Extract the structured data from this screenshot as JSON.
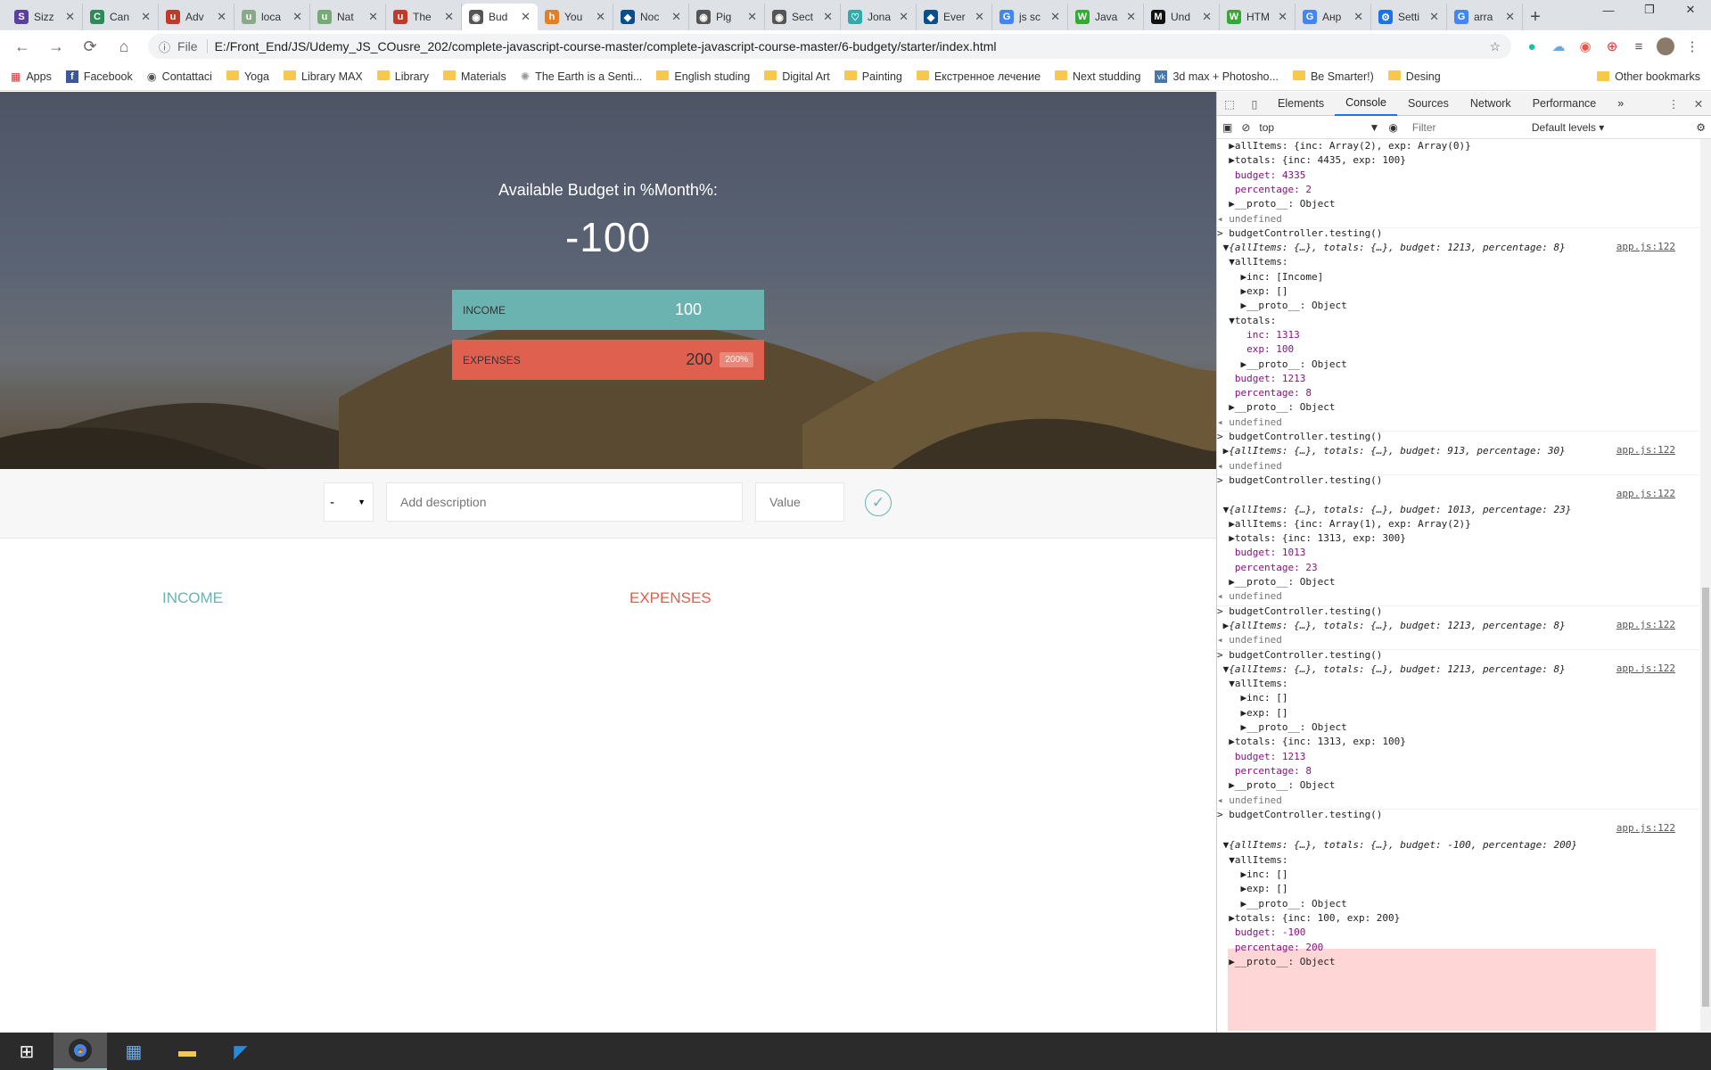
{
  "browser": {
    "tabs": [
      {
        "label": "Sizz",
        "color": "#5a3fa0",
        "glyph": "S"
      },
      {
        "label": "Can",
        "color": "#2e8b57",
        "glyph": "C"
      },
      {
        "label": "Adv",
        "color": "#c0392b",
        "glyph": "u"
      },
      {
        "label": "loca",
        "color": "#8a8",
        "glyph": "u"
      },
      {
        "label": "Nat",
        "color": "#7a7",
        "glyph": "u"
      },
      {
        "label": "The",
        "color": "#c0392b",
        "glyph": "u"
      },
      {
        "label": "Bud",
        "color": "#555",
        "glyph": "◉",
        "active": true
      },
      {
        "label": "You",
        "color": "#e67e22",
        "glyph": "h"
      },
      {
        "label": "Noc",
        "color": "#0b4f8a",
        "glyph": "◆"
      },
      {
        "label": "Pig",
        "color": "#555",
        "glyph": "◉"
      },
      {
        "label": "Sect",
        "color": "#555",
        "glyph": "◉"
      },
      {
        "label": "Jona",
        "color": "#3aa",
        "glyph": "♡"
      },
      {
        "label": "Ever",
        "color": "#0b4f8a",
        "glyph": "◆"
      },
      {
        "label": "js sc",
        "color": "#4285f4",
        "glyph": "G"
      },
      {
        "label": "Java",
        "color": "#3a3",
        "glyph": "W"
      },
      {
        "label": "Und",
        "color": "#111",
        "glyph": "M"
      },
      {
        "label": "HTM",
        "color": "#3a3",
        "glyph": "W"
      },
      {
        "label": "Анр",
        "color": "#4285f4",
        "glyph": "G"
      },
      {
        "label": "Setti",
        "color": "#1a73e8",
        "glyph": "⚙"
      },
      {
        "label": "arra",
        "color": "#4285f4",
        "glyph": "G"
      }
    ],
    "url_scheme": "File",
    "url": "E:/Front_End/JS/Udemy_JS_COusre_202/complete-javascript-course-master/complete-javascript-course-master/6-budgety/starter/index.html",
    "bookmarks": [
      {
        "label": "Apps",
        "type": "apps"
      },
      {
        "label": "Facebook",
        "type": "fb"
      },
      {
        "label": "Contattaci",
        "type": "globe"
      },
      {
        "label": "Yoga",
        "type": "folder"
      },
      {
        "label": "Library MAX",
        "type": "folder"
      },
      {
        "label": "Library",
        "type": "folder"
      },
      {
        "label": "Materials",
        "type": "folder"
      },
      {
        "label": "The Earth is a Senti...",
        "type": "sun"
      },
      {
        "label": "English studing",
        "type": "folder"
      },
      {
        "label": "Digital Art",
        "type": "folder"
      },
      {
        "label": "Painting",
        "type": "folder"
      },
      {
        "label": "Екстренное лечение",
        "type": "folder"
      },
      {
        "label": "Next studding",
        "type": "folder"
      },
      {
        "label": "3d max + Photosho...",
        "type": "vk"
      },
      {
        "label": "Be Smarter!)",
        "type": "folder"
      },
      {
        "label": "Desing",
        "type": "folder"
      }
    ],
    "bookmarks_overflow": "»",
    "other_bookmarks": "Other bookmarks"
  },
  "app": {
    "budget_title": "Available Budget in %Month%:",
    "budget_value": "-100",
    "income_label": "Income",
    "income_value": "100",
    "expenses_label": "Expenses",
    "expenses_value": "200",
    "expenses_percentage": "200%",
    "type_select": "-",
    "description_placeholder": "Add description",
    "value_placeholder": "Value",
    "income_list_title": "Income",
    "expenses_list_title": "Expenses",
    "colors": {
      "income": "#6bb3b0",
      "expenses": "#e0604f"
    }
  },
  "devtools": {
    "tabs": [
      "Elements",
      "Console",
      "Sources",
      "Network",
      "Performance"
    ],
    "active_tab": "Console",
    "context": "top",
    "filter_placeholder": "Filter",
    "levels": "Default levels ▾",
    "console_lines": [
      "  ▶allItems: {inc: Array(2), exp: Array(0)}",
      "  ▶totals: {inc: 4435, exp: 100}",
      "   budget: 4335",
      "   percentage: 2",
      "  ▶__proto__: Object",
      "◂ undefined",
      "> budgetController.testing()",
      " ▼{allItems: {…}, totals: {…}, budget: 1213, percentage: 8}",
      "  ▼allItems:",
      "    ▶inc: [Income]",
      "    ▶exp: []",
      "    ▶__proto__: Object",
      "  ▼totals:",
      "     inc: 1313",
      "     exp: 100",
      "    ▶__proto__: Object",
      "   budget: 1213",
      "   percentage: 8",
      "  ▶__proto__: Object",
      "◂ undefined",
      "> budgetController.testing()",
      " ▶{allItems: {…}, totals: {…}, budget: 913, percentage: 30}",
      "◂ undefined",
      "> budgetController.testing()",
      "",
      " ▼{allItems: {…}, totals: {…}, budget: 1013, percentage: 23}",
      "  ▶allItems: {inc: Array(1), exp: Array(2)}",
      "  ▶totals: {inc: 1313, exp: 300}",
      "   budget: 1013",
      "   percentage: 23",
      "  ▶__proto__: Object",
      "◂ undefined",
      "> budgetController.testing()",
      " ▶{allItems: {…}, totals: {…}, budget: 1213, percentage: 8}",
      "◂ undefined",
      "> budgetController.testing()",
      " ▼{allItems: {…}, totals: {…}, budget: 1213, percentage: 8}",
      "  ▼allItems:",
      "    ▶inc: []",
      "    ▶exp: []",
      "    ▶__proto__: Object",
      "  ▶totals: {inc: 1313, exp: 100}",
      "   budget: 1213",
      "   percentage: 8",
      "  ▶__proto__: Object",
      "◂ undefined",
      "> budgetController.testing()",
      "",
      " ▼{allItems: {…}, totals: {…}, budget: -100, percentage: 200}",
      "  ▼allItems:",
      "    ▶inc: []",
      "    ▶exp: []",
      "    ▶__proto__: Object",
      "  ▶totals: {inc: 100, exp: 200}",
      "   budget: -100",
      "   percentage: 200",
      "  ▶__proto__: Object"
    ],
    "source_link": "app.js:122"
  }
}
